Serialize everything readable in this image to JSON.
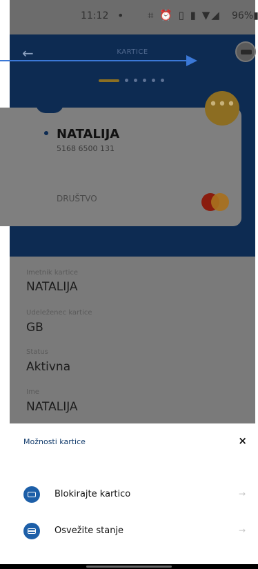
{
  "status_bar": {
    "time": "11:12",
    "dot": "•",
    "icons": "⌗ ⏰ ▯ ▮ ▼◢",
    "battery": "96%▮"
  },
  "header": {
    "back": "←",
    "title": "KARTICE",
    "pager_dots": 5
  },
  "card": {
    "holder_name": "NATALIJA",
    "number": "5168 6500 131",
    "company": "DRUŠTVO",
    "more_icon": "•••",
    "brand_icon": "mastercard-logo"
  },
  "details": [
    {
      "label": "Imetnik kartice",
      "value": "NATALIJA"
    },
    {
      "label": "Udeleženec kartice",
      "value": "GB"
    },
    {
      "label": "Status",
      "value": "Aktivna"
    },
    {
      "label": "Ime",
      "value": "NATALIJA"
    }
  ],
  "sheet": {
    "title": "Možnosti kartice",
    "close": "×",
    "options": [
      {
        "label": "Blokirajte kartico",
        "icon": "card-lock-icon",
        "arrow": "→"
      },
      {
        "label": "Osvežite stanje",
        "icon": "card-refresh-icon",
        "arrow": "→"
      }
    ]
  },
  "colors": {
    "header": "#0d2b52",
    "accent": "#1d5fa8",
    "pointer": "#3b78d6"
  }
}
